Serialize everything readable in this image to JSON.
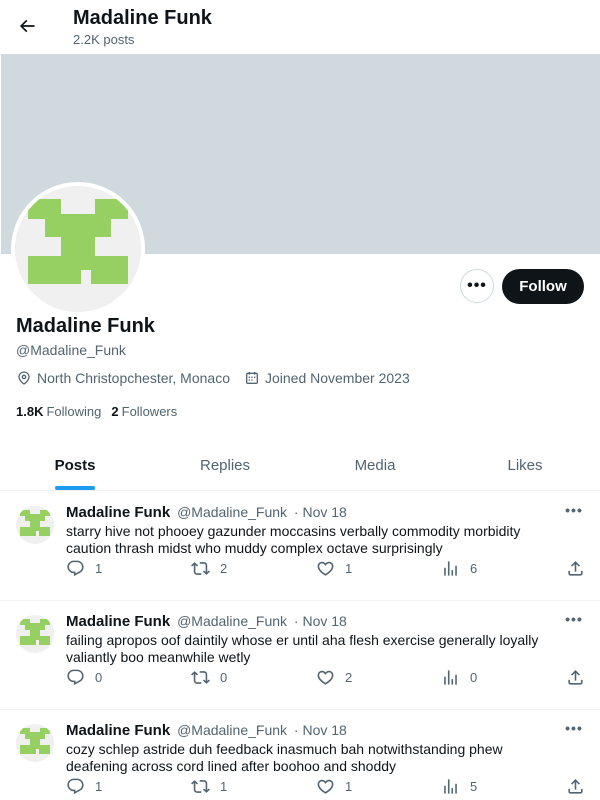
{
  "header": {
    "back_icon": "arrow-left-icon",
    "title": "Madaline Funk",
    "post_count": "2.2K posts"
  },
  "colors": {
    "banner": "#cfd9de",
    "avatar_green": "#96cf62",
    "accent": "#1d9bf0",
    "text_primary": "#0f1419",
    "text_secondary": "#536471"
  },
  "profile": {
    "name": "Madaline Funk",
    "handle": "@Madaline_Funk",
    "location": "North Christopchester, Monaco",
    "joined": "Joined November 2023",
    "following_count": "1.8K",
    "following_label": "Following",
    "followers_count": "2",
    "followers_label": "Followers",
    "more_label": "•••",
    "follow_label": "Follow"
  },
  "tabs": [
    {
      "label": "Posts",
      "active": true
    },
    {
      "label": "Replies",
      "active": false
    },
    {
      "label": "Media",
      "active": false
    },
    {
      "label": "Likes",
      "active": false
    }
  ],
  "posts": [
    {
      "name": "Madaline Funk",
      "handle": "@Madaline_Funk",
      "date": "· Nov 18",
      "text": "starry hive not phooey gazunder moccasins verbally commodity morbidity caution thrash midst who muddy complex octave surprisingly",
      "replies": "1",
      "reposts": "2",
      "likes": "1",
      "views": "6"
    },
    {
      "name": "Madaline Funk",
      "handle": "@Madaline_Funk",
      "date": "· Nov 18",
      "text": "failing apropos oof daintily whose er until aha flesh exercise generally loyally valiantly boo meanwhile wetly",
      "replies": "0",
      "reposts": "0",
      "likes": "2",
      "views": "0"
    },
    {
      "name": "Madaline Funk",
      "handle": "@Madaline_Funk",
      "date": "· Nov 18",
      "text": "cozy schlep astride duh feedback inasmuch bah notwithstanding phew deafening across cord lined after boohoo and shoddy",
      "replies": "1",
      "reposts": "1",
      "likes": "1",
      "views": "5"
    }
  ],
  "post_more_label": "•••"
}
